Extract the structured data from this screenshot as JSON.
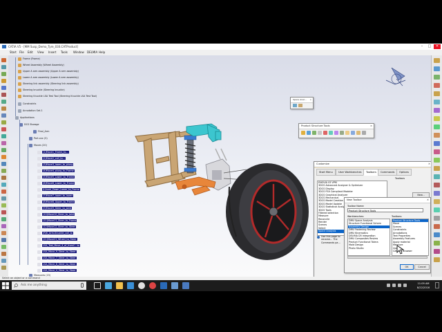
{
  "window": {
    "title": "CATIA V5 - [MM Susp_Demo_Tyre_030.CATProduct]",
    "controls": [
      "–",
      "□",
      "✕"
    ]
  },
  "menu": [
    "Start",
    "File",
    "Edit",
    "View",
    "Insert",
    "Tools",
    "Window",
    "DELMIA",
    "Help"
  ],
  "tree": [
    {
      "label": "Frame (Frame)",
      "hl": false
    },
    {
      "label": "Wheel Assembly (Wheel Assembly)",
      "hl": false
    },
    {
      "label": "Upper A arm assembly (Upper A arm assembly)",
      "hl": false
    },
    {
      "label": "Lower A arm assembly (Lower A arm assembly)",
      "hl": false
    },
    {
      "label": "Steering link assembly (Steering link assembly)",
      "hl": false
    },
    {
      "label": "Steering knuckle (Steering knuckle)",
      "hl": false
    },
    {
      "label": "Steering Knuckle LSA Test Tool (Steering Knuckle LSA Test Tool)",
      "hl": false
    },
    {
      "label": "Constraints",
      "hl": false
    },
    {
      "label": "Annotation Set.1",
      "hl": false
    },
    {
      "label": "Applications",
      "hl": false
    },
    {
      "label": "DCS Storage",
      "hl": false
    },
    {
      "label": "Final_Arm",
      "hl": false
    },
    {
      "label": "Part.xxx (5)",
      "hl": false
    },
    {
      "label": "Moves (20)",
      "hl": false
    },
    {
      "label": "(1)Move1_Frame_to...",
      "hl": true
    },
    {
      "label": "(2)Move2_coll_to...",
      "hl": true
    },
    {
      "label": "(3)Move3_lower_to_plung",
      "hl": true
    },
    {
      "label": "(4)Move4_plung_to_Frame",
      "hl": true
    },
    {
      "label": "(5)Move5_Lower_to_Frame",
      "hl": true
    },
    {
      "label": "(6)Move6_Lower_to_Frame",
      "hl": true
    },
    {
      "label": "(L)Lock_Down_Lower_to_Frame",
      "hl": true
    },
    {
      "label": "(7)Move7_lower_to_lower",
      "hl": true
    },
    {
      "label": "(8)Move8_Upper_to_Frame",
      "hl": true
    },
    {
      "label": "(9)Move9_Steer_to_Joint",
      "hl": true
    },
    {
      "label": "(10)Move10_Steer_to_Joint",
      "hl": true
    },
    {
      "label": "(11)Move11_Steer_to_Frame",
      "hl": true
    },
    {
      "label": "(12)Move12_Steer_to_Steer",
      "hl": true
    },
    {
      "label": "(R)K_Arm-Knuckle_coll_to",
      "hl": true
    },
    {
      "label": "(21)Move21_Wheel_to_Steer",
      "hl": true
    },
    {
      "label": "LSA_Test_Move_4_of_fromC...to",
      "hl": true
    },
    {
      "label": "LSA_Move_9_Steer_to_Steer",
      "hl": true
    },
    {
      "label": "LSA_Move_7_Steer_to_Steer",
      "hl": true
    },
    {
      "label": "LSA_Move_8_Steer_to_Steer",
      "hl": true
    },
    {
      "label": "LSA_Move_4_Steer_to_Steer",
      "hl": true
    },
    {
      "label": "Measures (15)",
      "hl": false
    }
  ],
  "space_analysis_toolbar": {
    "title": "Space Anal..."
  },
  "product_structure_toolbar": {
    "title": "Product Structure Tools"
  },
  "customize": {
    "title": "Customize",
    "close": "✕",
    "tabs": [
      "Start Menu",
      "User Workbenches",
      "Toolbars",
      "Commands",
      "Options"
    ],
    "toolbars_header": "Toolbars",
    "toolbar_list": [
      "ENOVIA V5 VPM",
      "3DCS Advanced Analyzer & Optimizer",
      "3DCS Display",
      "3DCS FEA Compliant Modeler",
      "3DCS Graphical Analyzer",
      "3DCS Mechanical",
      "3DCS Model Creation",
      "3DCS Model Update",
      "3DCS Statistical Analyzer",
      "3DCS Tools",
      "Filtered selection",
      "Measure",
      "Reconcile",
      "Render",
      "Scenes",
      "Select",
      "Space Analysis"
    ],
    "side_buttons": [
      "New...",
      "Rename...",
      "Delete"
    ],
    "help_text": "Use this page to rename... The Commands pa..."
  },
  "new_toolbar": {
    "title": "New Toolbar",
    "close": "✕",
    "name_label": "Toolbar Name:",
    "name_value": "Product Structure Tools",
    "workbenches_label": "Workbenches:",
    "toolbars_label": "Toolbars:",
    "workbenches": [
      "DMU Space Analysis",
      "Structure Functional Schem",
      "Assembly Design",
      "DMU Fastening Review",
      "DMU Kinematics",
      "DELMIA D5 Integration",
      "DMU Composites Review",
      "Product Functional Tolera",
      "Mold Design",
      "Photo Studio"
    ],
    "toolbars": [
      "Product Structure Tools",
      "Move",
      "Scenes",
      "Constraints",
      "Annotations",
      "Text Properties",
      "Assembly Features",
      "Apply material",
      "Measure",
      "Update",
      "Catalog Browser"
    ],
    "ok": "OK",
    "cancel": "Cancel"
  },
  "status": "Select an object or a command",
  "taskbar": {
    "search_placeholder": "Ask me anything",
    "time": "11:09 AM",
    "date": "8/22/2016"
  }
}
